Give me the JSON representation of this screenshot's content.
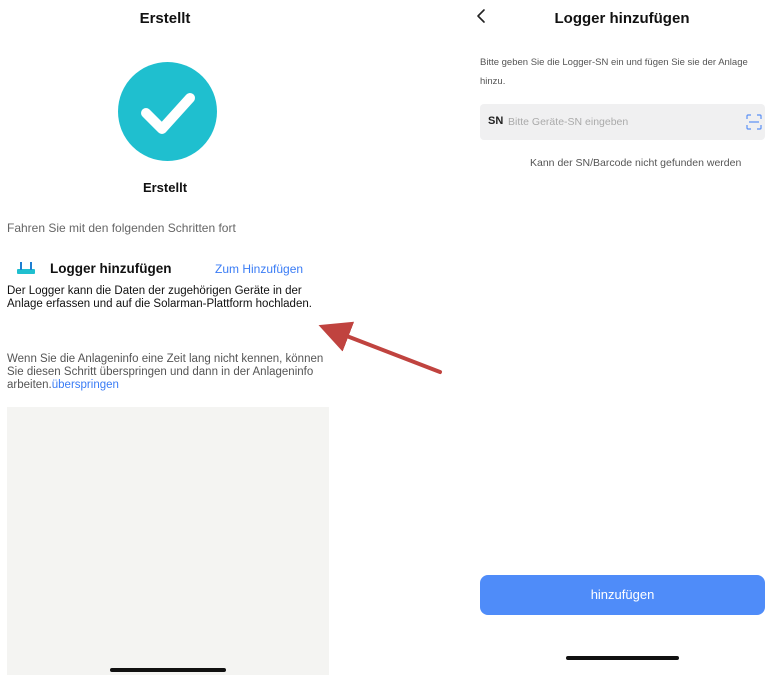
{
  "left": {
    "title": "Erstellt",
    "success_label": "Erstellt",
    "steps_intro": "Fahren Sie mit den folgenden Schritten fort",
    "step": {
      "icon": "router-icon",
      "title": "Logger hinzufügen",
      "action": "Zum Hinzufügen",
      "description": "Der Logger kann die Daten der zugehörigen Geräte in der Anlage erfassen und auf die Solarman-Plattform hochladen."
    },
    "skip_text": "Wenn Sie die Anlageninfo eine Zeit lang nicht kennen, können Sie diesen Schritt überspringen und dann in der Anlageninfo arbeiten.",
    "skip_link": "überspringen",
    "colors": {
      "check_circle": "#1fbfcf",
      "link": "#3a7cf5"
    }
  },
  "right": {
    "back_icon": "chevron-left-icon",
    "title": "Logger hinzufügen",
    "instruction": "Bitte geben Sie die Logger-SN ein und fügen Sie sie der Anlage hinzu.",
    "sn_prefix": "SN",
    "sn_placeholder": "Bitte Geräte-SN eingeben",
    "sn_value": "",
    "scan_icon": "scan-icon",
    "cant_find": "Kann der SN/Barcode nicht gefunden werden",
    "add_button": "hinzufügen",
    "colors": {
      "button": "#4f8cf9"
    }
  },
  "annotation": {
    "arrow_color": "#c0433f"
  }
}
